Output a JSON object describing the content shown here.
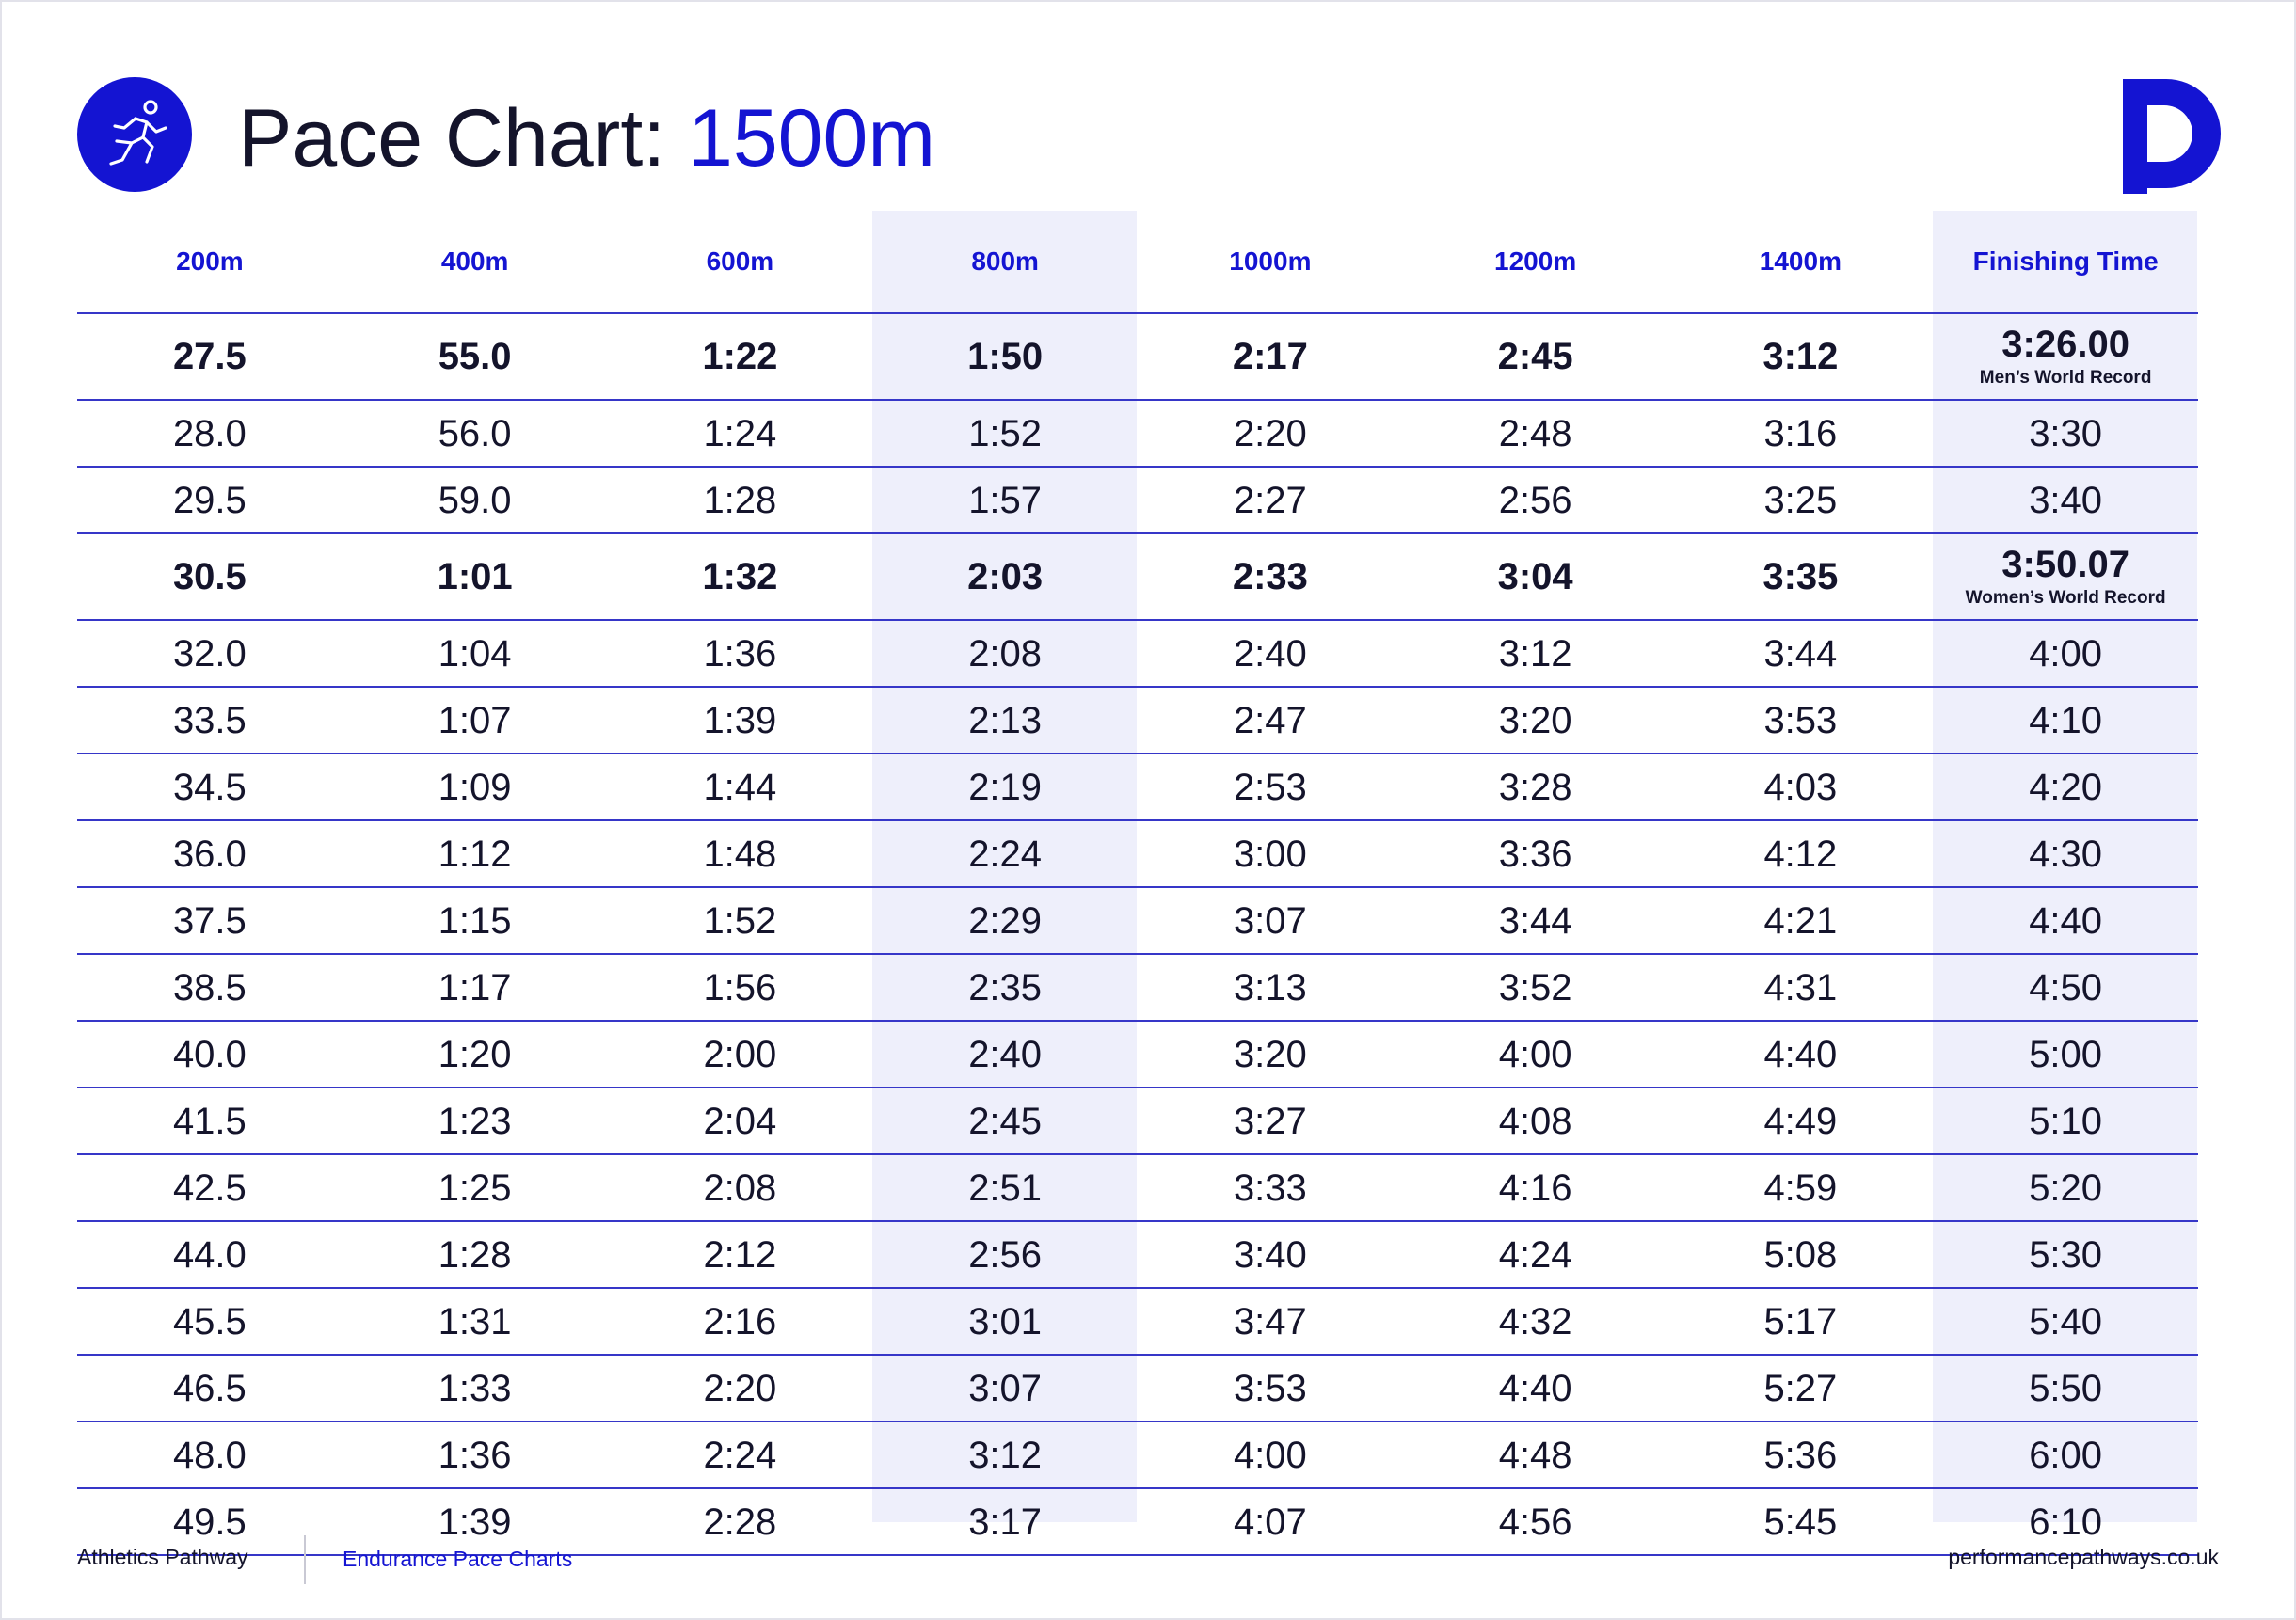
{
  "title": {
    "prefix": "Pace Chart: ",
    "event": "1500m"
  },
  "icons": {
    "logo": "runner-icon",
    "brand": "pathways-p-logo-icon"
  },
  "colors": {
    "accent": "#1414d2",
    "column_shade": "#eeeffb",
    "text": "#14142b",
    "rule": "#3636c8"
  },
  "table": {
    "headers": [
      "200m",
      "400m",
      "600m",
      "800m",
      "1000m",
      "1200m",
      "1400m",
      "Finishing Time"
    ],
    "highlighted_columns": [
      "800m",
      "Finishing Time"
    ],
    "rows": [
      {
        "values": [
          "27.5",
          "55.0",
          "1:22",
          "1:50",
          "2:17",
          "2:45",
          "3:12",
          "3:26.00"
        ],
        "note": "Men’s World Record",
        "bold": true
      },
      {
        "values": [
          "28.0",
          "56.0",
          "1:24",
          "1:52",
          "2:20",
          "2:48",
          "3:16",
          "3:30"
        ]
      },
      {
        "values": [
          "29.5",
          "59.0",
          "1:28",
          "1:57",
          "2:27",
          "2:56",
          "3:25",
          "3:40"
        ]
      },
      {
        "values": [
          "30.5",
          "1:01",
          "1:32",
          "2:03",
          "2:33",
          "3:04",
          "3:35",
          "3:50.07"
        ],
        "note": "Women’s World Record",
        "bold": true
      },
      {
        "values": [
          "32.0",
          "1:04",
          "1:36",
          "2:08",
          "2:40",
          "3:12",
          "3:44",
          "4:00"
        ]
      },
      {
        "values": [
          "33.5",
          "1:07",
          "1:39",
          "2:13",
          "2:47",
          "3:20",
          "3:53",
          "4:10"
        ]
      },
      {
        "values": [
          "34.5",
          "1:09",
          "1:44",
          "2:19",
          "2:53",
          "3:28",
          "4:03",
          "4:20"
        ]
      },
      {
        "values": [
          "36.0",
          "1:12",
          "1:48",
          "2:24",
          "3:00",
          "3:36",
          "4:12",
          "4:30"
        ]
      },
      {
        "values": [
          "37.5",
          "1:15",
          "1:52",
          "2:29",
          "3:07",
          "3:44",
          "4:21",
          "4:40"
        ]
      },
      {
        "values": [
          "38.5",
          "1:17",
          "1:56",
          "2:35",
          "3:13",
          "3:52",
          "4:31",
          "4:50"
        ]
      },
      {
        "values": [
          "40.0",
          "1:20",
          "2:00",
          "2:40",
          "3:20",
          "4:00",
          "4:40",
          "5:00"
        ]
      },
      {
        "values": [
          "41.5",
          "1:23",
          "2:04",
          "2:45",
          "3:27",
          "4:08",
          "4:49",
          "5:10"
        ]
      },
      {
        "values": [
          "42.5",
          "1:25",
          "2:08",
          "2:51",
          "3:33",
          "4:16",
          "4:59",
          "5:20"
        ]
      },
      {
        "values": [
          "44.0",
          "1:28",
          "2:12",
          "2:56",
          "3:40",
          "4:24",
          "5:08",
          "5:30"
        ]
      },
      {
        "values": [
          "45.5",
          "1:31",
          "2:16",
          "3:01",
          "3:47",
          "4:32",
          "5:17",
          "5:40"
        ]
      },
      {
        "values": [
          "46.5",
          "1:33",
          "2:20",
          "3:07",
          "3:53",
          "4:40",
          "5:27",
          "5:50"
        ]
      },
      {
        "values": [
          "48.0",
          "1:36",
          "2:24",
          "3:12",
          "4:00",
          "4:48",
          "5:36",
          "6:00"
        ]
      },
      {
        "values": [
          "49.5",
          "1:39",
          "2:28",
          "3:17",
          "4:07",
          "4:56",
          "5:45",
          "6:10"
        ]
      }
    ]
  },
  "footer": {
    "left": "Athletics Pathway",
    "middle": "Endurance Pace Charts",
    "right": "performancepathways.co.uk"
  }
}
